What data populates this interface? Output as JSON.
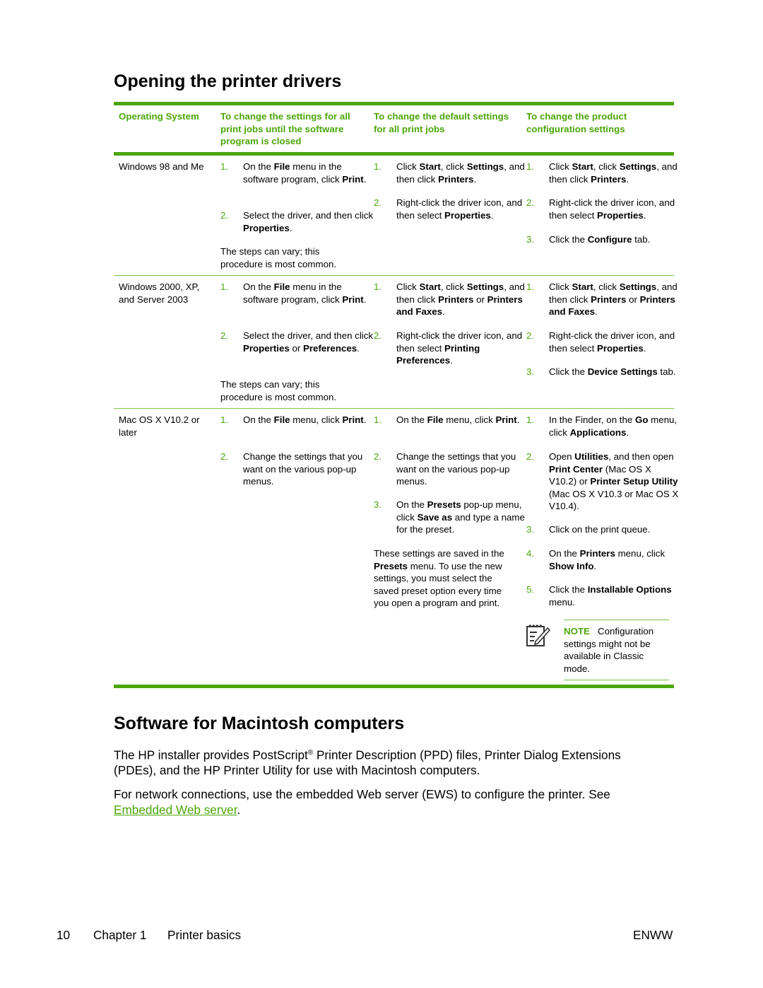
{
  "section1": {
    "title": "Opening the printer drivers",
    "table": {
      "headers": [
        "Operating System",
        "To change the settings for all print jobs until the software program is closed",
        "To change the default settings for all print jobs",
        "To change the product configuration settings"
      ],
      "rows": [
        {
          "os": "Windows 98 and Me",
          "col1": {
            "steps": [
              {
                "num": "1.",
                "html": "On the <b>File</b> menu in the software program, click <b>Print</b>."
              },
              {
                "num": "2.",
                "html": "Select the driver, and then click <b>Properties</b>."
              }
            ],
            "footnote": "The steps can vary; this procedure is most common."
          },
          "col2": {
            "steps": [
              {
                "num": "1.",
                "html": "Click <b>Start</b>, click <b>Settings</b>, and then click <b>Printers</b>."
              },
              {
                "num": "2.",
                "html": "Right-click the driver icon, and then select <b>Properties</b>."
              }
            ]
          },
          "col3": {
            "steps": [
              {
                "num": "1.",
                "html": "Click <b>Start</b>, click <b>Settings</b>, and then click <b>Printers</b>."
              },
              {
                "num": "2.",
                "html": "Right-click the driver icon, and then select <b>Properties</b>."
              },
              {
                "num": "3.",
                "html": "Click the <b>Configure</b> tab."
              }
            ]
          }
        },
        {
          "os": "Windows 2000, XP, and Server 2003",
          "col1": {
            "steps": [
              {
                "num": "1.",
                "html": "On the <b>File</b> menu in the software program, click <b>Print</b>."
              },
              {
                "num": "2.",
                "html": "Select the driver, and then click <b>Properties</b> or <b>Preferences</b>."
              }
            ],
            "footnote": "The steps can vary; this procedure is most common."
          },
          "col2": {
            "steps": [
              {
                "num": "1.",
                "html": "Click <b>Start</b>, click <b>Settings</b>, and then click <b>Printers</b> or <b>Printers and Faxes</b>."
              },
              {
                "num": "2.",
                "html": "Right-click the driver icon, and then select <b>Printing Preferences</b>."
              }
            ]
          },
          "col3": {
            "steps": [
              {
                "num": "1.",
                "html": "Click <b>Start</b>, click <b>Settings</b>, and then click <b>Printers</b> or <b>Printers and Faxes</b>."
              },
              {
                "num": "2.",
                "html": "Right-click the driver icon, and then select <b>Properties</b>."
              },
              {
                "num": "3.",
                "html": "Click the <b>Device Settings</b> tab."
              }
            ]
          }
        },
        {
          "os": "Mac OS X V10.2 or later",
          "col1": {
            "steps": [
              {
                "num": "1.",
                "html": "On the <b>File</b> menu, click <b>Print</b>."
              },
              {
                "num": "2.",
                "html": "Change the settings that you want on the various pop-up menus."
              }
            ]
          },
          "col2": {
            "steps": [
              {
                "num": "1.",
                "html": "On the <b>File</b> menu, click <b>Print</b>."
              },
              {
                "num": "2.",
                "html": "Change the settings that you want on the various pop-up menus."
              },
              {
                "num": "3.",
                "html": "On the <b>Presets</b> pop-up menu, click <b>Save as</b> and type a name for the preset."
              }
            ],
            "footnote_html": "These settings are saved in the <b>Presets</b> menu. To use the new settings, you must select the saved preset option every time you open a program and print."
          },
          "col3": {
            "steps": [
              {
                "num": "1.",
                "html": "In the Finder, on the <b>Go</b> menu, click <b>Applications</b>."
              },
              {
                "num": "2.",
                "html": "Open <b>Utilities</b>, and then open <b>Print Center</b> (Mac OS X V10.2) or <b>Printer Setup Utility</b> (Mac OS X V10.3 or Mac OS X V10.4)."
              },
              {
                "num": "3.",
                "html": "Click on the print queue."
              },
              {
                "num": "4.",
                "html": "On the <b>Printers</b> menu, click <b>Show Info</b>."
              },
              {
                "num": "5.",
                "html": "Click the <b>Installable Options</b> menu."
              }
            ],
            "note": {
              "label": "NOTE",
              "text": "Configuration settings might not be available in Classic mode.",
              "icon": "note-pad-pencil-icon"
            }
          }
        }
      ]
    }
  },
  "section2": {
    "title": "Software for Macintosh computers",
    "para1_before": "The HP installer provides PostScript",
    "para1_sup": "®",
    "para1_after": " Printer Description (PPD) files, Printer Dialog Extensions (PDEs), and the HP Printer Utility for use with Macintosh computers.",
    "para2_before": "For network connections, use the embedded Web server (EWS) to configure the printer. See ",
    "para2_link": "Embedded Web server",
    "para2_after": "."
  },
  "footer": {
    "page_number": "10",
    "chapter": "Chapter 1",
    "chapter_title": "Printer basics",
    "locale": "ENWW"
  },
  "colors": {
    "accent_green": "#4ca60a",
    "rule_light_green": "#7cc444"
  }
}
